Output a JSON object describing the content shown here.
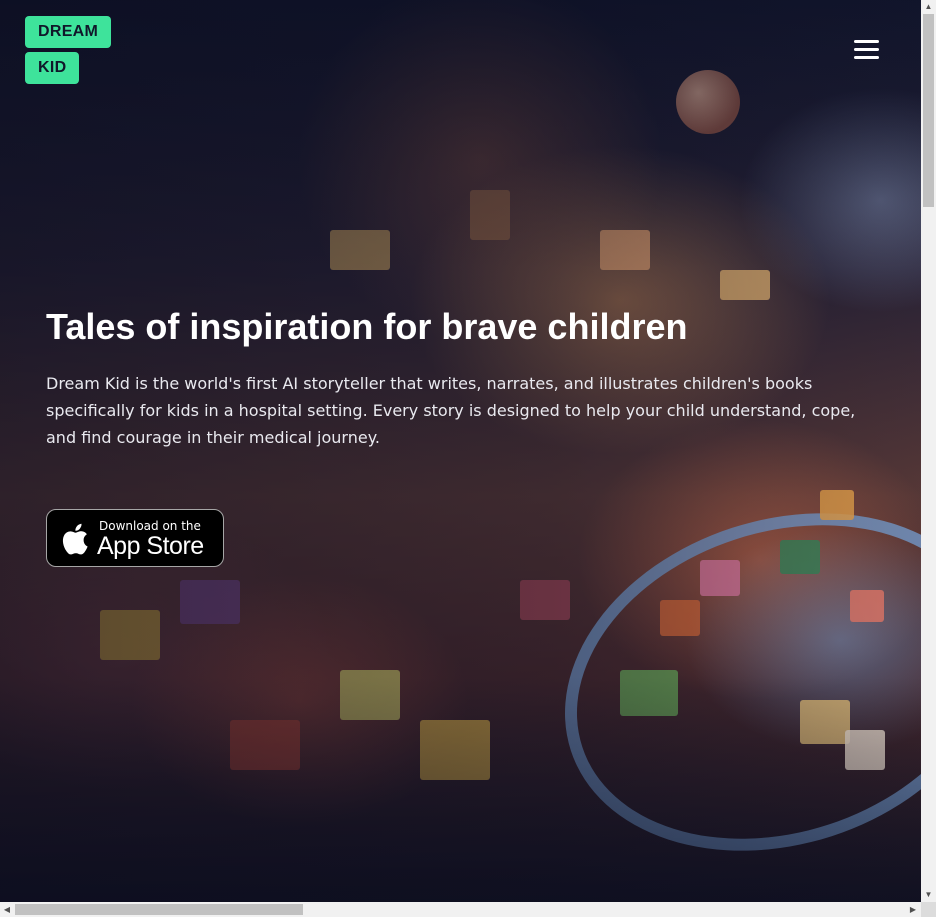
{
  "header": {
    "logo_line1": "DREAM",
    "logo_line2": "KID",
    "menu_icon": "hamburger-menu-icon"
  },
  "hero": {
    "title": "Tales of inspiration for brave children",
    "description": "Dream Kid is the world's first AI storyteller that writes, narrates, and illustrates children's books specifically for kids in a hospital setting. Every story is designed to help your child understand, cope, and find courage in their medical journey.",
    "cta": {
      "small_text": "Download on the",
      "big_text": "App Store",
      "icon": "apple-icon"
    }
  },
  "colors": {
    "logo_bg": "#3ee39b",
    "logo_text": "#10182a",
    "text": "#ffffff",
    "button_bg": "#000000"
  },
  "scrollbars": {
    "vertical_up": "▲",
    "vertical_down": "▼",
    "horizontal_left": "◀",
    "horizontal_right": "▶"
  }
}
